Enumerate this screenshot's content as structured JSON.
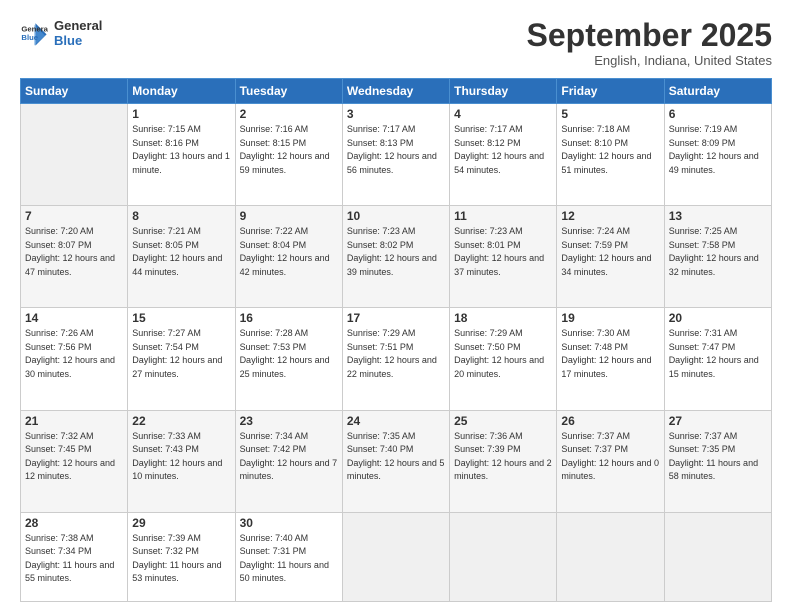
{
  "header": {
    "logo_general": "General",
    "logo_blue": "Blue",
    "month_title": "September 2025",
    "location": "English, Indiana, United States"
  },
  "days_of_week": [
    "Sunday",
    "Monday",
    "Tuesday",
    "Wednesday",
    "Thursday",
    "Friday",
    "Saturday"
  ],
  "weeks": [
    [
      {
        "day": "",
        "sunrise": "",
        "sunset": "",
        "daylight": ""
      },
      {
        "day": "1",
        "sunrise": "Sunrise: 7:15 AM",
        "sunset": "Sunset: 8:16 PM",
        "daylight": "Daylight: 13 hours and 1 minute."
      },
      {
        "day": "2",
        "sunrise": "Sunrise: 7:16 AM",
        "sunset": "Sunset: 8:15 PM",
        "daylight": "Daylight: 12 hours and 59 minutes."
      },
      {
        "day": "3",
        "sunrise": "Sunrise: 7:17 AM",
        "sunset": "Sunset: 8:13 PM",
        "daylight": "Daylight: 12 hours and 56 minutes."
      },
      {
        "day": "4",
        "sunrise": "Sunrise: 7:17 AM",
        "sunset": "Sunset: 8:12 PM",
        "daylight": "Daylight: 12 hours and 54 minutes."
      },
      {
        "day": "5",
        "sunrise": "Sunrise: 7:18 AM",
        "sunset": "Sunset: 8:10 PM",
        "daylight": "Daylight: 12 hours and 51 minutes."
      },
      {
        "day": "6",
        "sunrise": "Sunrise: 7:19 AM",
        "sunset": "Sunset: 8:09 PM",
        "daylight": "Daylight: 12 hours and 49 minutes."
      }
    ],
    [
      {
        "day": "7",
        "sunrise": "Sunrise: 7:20 AM",
        "sunset": "Sunset: 8:07 PM",
        "daylight": "Daylight: 12 hours and 47 minutes."
      },
      {
        "day": "8",
        "sunrise": "Sunrise: 7:21 AM",
        "sunset": "Sunset: 8:05 PM",
        "daylight": "Daylight: 12 hours and 44 minutes."
      },
      {
        "day": "9",
        "sunrise": "Sunrise: 7:22 AM",
        "sunset": "Sunset: 8:04 PM",
        "daylight": "Daylight: 12 hours and 42 minutes."
      },
      {
        "day": "10",
        "sunrise": "Sunrise: 7:23 AM",
        "sunset": "Sunset: 8:02 PM",
        "daylight": "Daylight: 12 hours and 39 minutes."
      },
      {
        "day": "11",
        "sunrise": "Sunrise: 7:23 AM",
        "sunset": "Sunset: 8:01 PM",
        "daylight": "Daylight: 12 hours and 37 minutes."
      },
      {
        "day": "12",
        "sunrise": "Sunrise: 7:24 AM",
        "sunset": "Sunset: 7:59 PM",
        "daylight": "Daylight: 12 hours and 34 minutes."
      },
      {
        "day": "13",
        "sunrise": "Sunrise: 7:25 AM",
        "sunset": "Sunset: 7:58 PM",
        "daylight": "Daylight: 12 hours and 32 minutes."
      }
    ],
    [
      {
        "day": "14",
        "sunrise": "Sunrise: 7:26 AM",
        "sunset": "Sunset: 7:56 PM",
        "daylight": "Daylight: 12 hours and 30 minutes."
      },
      {
        "day": "15",
        "sunrise": "Sunrise: 7:27 AM",
        "sunset": "Sunset: 7:54 PM",
        "daylight": "Daylight: 12 hours and 27 minutes."
      },
      {
        "day": "16",
        "sunrise": "Sunrise: 7:28 AM",
        "sunset": "Sunset: 7:53 PM",
        "daylight": "Daylight: 12 hours and 25 minutes."
      },
      {
        "day": "17",
        "sunrise": "Sunrise: 7:29 AM",
        "sunset": "Sunset: 7:51 PM",
        "daylight": "Daylight: 12 hours and 22 minutes."
      },
      {
        "day": "18",
        "sunrise": "Sunrise: 7:29 AM",
        "sunset": "Sunset: 7:50 PM",
        "daylight": "Daylight: 12 hours and 20 minutes."
      },
      {
        "day": "19",
        "sunrise": "Sunrise: 7:30 AM",
        "sunset": "Sunset: 7:48 PM",
        "daylight": "Daylight: 12 hours and 17 minutes."
      },
      {
        "day": "20",
        "sunrise": "Sunrise: 7:31 AM",
        "sunset": "Sunset: 7:47 PM",
        "daylight": "Daylight: 12 hours and 15 minutes."
      }
    ],
    [
      {
        "day": "21",
        "sunrise": "Sunrise: 7:32 AM",
        "sunset": "Sunset: 7:45 PM",
        "daylight": "Daylight: 12 hours and 12 minutes."
      },
      {
        "day": "22",
        "sunrise": "Sunrise: 7:33 AM",
        "sunset": "Sunset: 7:43 PM",
        "daylight": "Daylight: 12 hours and 10 minutes."
      },
      {
        "day": "23",
        "sunrise": "Sunrise: 7:34 AM",
        "sunset": "Sunset: 7:42 PM",
        "daylight": "Daylight: 12 hours and 7 minutes."
      },
      {
        "day": "24",
        "sunrise": "Sunrise: 7:35 AM",
        "sunset": "Sunset: 7:40 PM",
        "daylight": "Daylight: 12 hours and 5 minutes."
      },
      {
        "day": "25",
        "sunrise": "Sunrise: 7:36 AM",
        "sunset": "Sunset: 7:39 PM",
        "daylight": "Daylight: 12 hours and 2 minutes."
      },
      {
        "day": "26",
        "sunrise": "Sunrise: 7:37 AM",
        "sunset": "Sunset: 7:37 PM",
        "daylight": "Daylight: 12 hours and 0 minutes."
      },
      {
        "day": "27",
        "sunrise": "Sunrise: 7:37 AM",
        "sunset": "Sunset: 7:35 PM",
        "daylight": "Daylight: 11 hours and 58 minutes."
      }
    ],
    [
      {
        "day": "28",
        "sunrise": "Sunrise: 7:38 AM",
        "sunset": "Sunset: 7:34 PM",
        "daylight": "Daylight: 11 hours and 55 minutes."
      },
      {
        "day": "29",
        "sunrise": "Sunrise: 7:39 AM",
        "sunset": "Sunset: 7:32 PM",
        "daylight": "Daylight: 11 hours and 53 minutes."
      },
      {
        "day": "30",
        "sunrise": "Sunrise: 7:40 AM",
        "sunset": "Sunset: 7:31 PM",
        "daylight": "Daylight: 11 hours and 50 minutes."
      },
      {
        "day": "",
        "sunrise": "",
        "sunset": "",
        "daylight": ""
      },
      {
        "day": "",
        "sunrise": "",
        "sunset": "",
        "daylight": ""
      },
      {
        "day": "",
        "sunrise": "",
        "sunset": "",
        "daylight": ""
      },
      {
        "day": "",
        "sunrise": "",
        "sunset": "",
        "daylight": ""
      }
    ]
  ]
}
